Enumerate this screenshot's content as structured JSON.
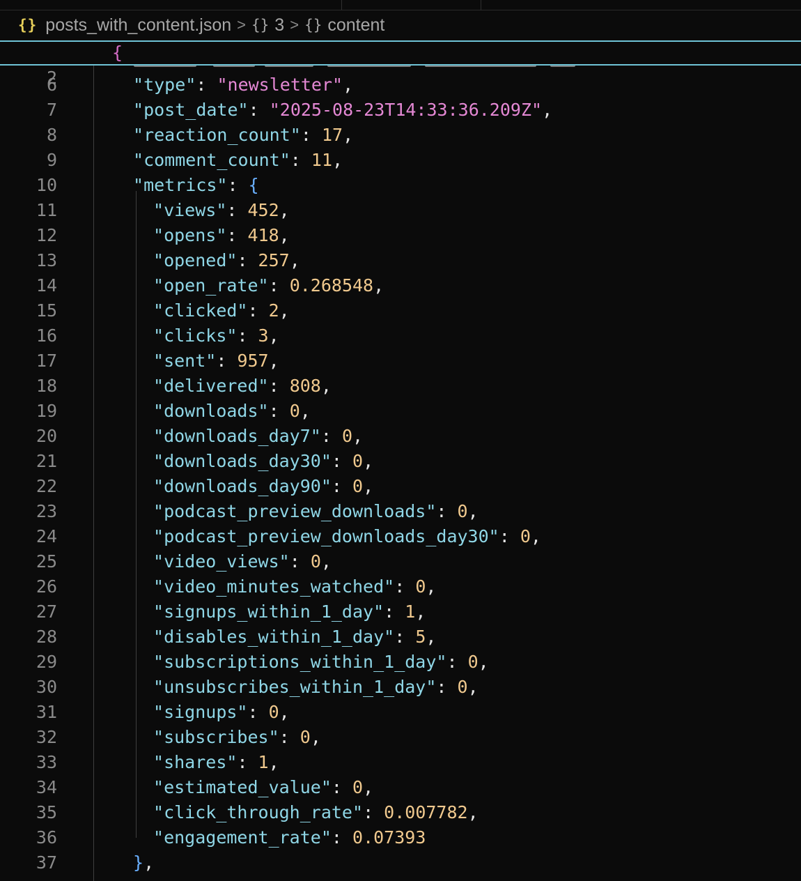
{
  "breadcrumb": {
    "file": "posts_with_content.json",
    "segments": [
      "3",
      "content"
    ]
  },
  "sticky_line": {
    "number": "2",
    "text": "{"
  },
  "lines": [
    {
      "n": "6",
      "indent": 1,
      "key": "type",
      "value": "newsletter",
      "vtype": "string",
      "comma": true
    },
    {
      "n": "7",
      "indent": 1,
      "key": "post_date",
      "value": "2025-08-23T14:33:36.209Z",
      "vtype": "string",
      "comma": true
    },
    {
      "n": "8",
      "indent": 1,
      "key": "reaction_count",
      "value": "17",
      "vtype": "number",
      "comma": true
    },
    {
      "n": "9",
      "indent": 1,
      "key": "comment_count",
      "value": "11",
      "vtype": "number",
      "comma": true
    },
    {
      "n": "10",
      "indent": 1,
      "key": "metrics",
      "value": "{",
      "vtype": "open",
      "comma": false
    },
    {
      "n": "11",
      "indent": 2,
      "key": "views",
      "value": "452",
      "vtype": "number",
      "comma": true
    },
    {
      "n": "12",
      "indent": 2,
      "key": "opens",
      "value": "418",
      "vtype": "number",
      "comma": true
    },
    {
      "n": "13",
      "indent": 2,
      "key": "opened",
      "value": "257",
      "vtype": "number",
      "comma": true
    },
    {
      "n": "14",
      "indent": 2,
      "key": "open_rate",
      "value": "0.268548",
      "vtype": "number",
      "comma": true
    },
    {
      "n": "15",
      "indent": 2,
      "key": "clicked",
      "value": "2",
      "vtype": "number",
      "comma": true
    },
    {
      "n": "16",
      "indent": 2,
      "key": "clicks",
      "value": "3",
      "vtype": "number",
      "comma": true
    },
    {
      "n": "17",
      "indent": 2,
      "key": "sent",
      "value": "957",
      "vtype": "number",
      "comma": true
    },
    {
      "n": "18",
      "indent": 2,
      "key": "delivered",
      "value": "808",
      "vtype": "number",
      "comma": true
    },
    {
      "n": "19",
      "indent": 2,
      "key": "downloads",
      "value": "0",
      "vtype": "number",
      "comma": true
    },
    {
      "n": "20",
      "indent": 2,
      "key": "downloads_day7",
      "value": "0",
      "vtype": "number",
      "comma": true
    },
    {
      "n": "21",
      "indent": 2,
      "key": "downloads_day30",
      "value": "0",
      "vtype": "number",
      "comma": true
    },
    {
      "n": "22",
      "indent": 2,
      "key": "downloads_day90",
      "value": "0",
      "vtype": "number",
      "comma": true
    },
    {
      "n": "23",
      "indent": 2,
      "key": "podcast_preview_downloads",
      "value": "0",
      "vtype": "number",
      "comma": true
    },
    {
      "n": "24",
      "indent": 2,
      "key": "podcast_preview_downloads_day30",
      "value": "0",
      "vtype": "number",
      "comma": true
    },
    {
      "n": "25",
      "indent": 2,
      "key": "video_views",
      "value": "0",
      "vtype": "number",
      "comma": true
    },
    {
      "n": "26",
      "indent": 2,
      "key": "video_minutes_watched",
      "value": "0",
      "vtype": "number",
      "comma": true
    },
    {
      "n": "27",
      "indent": 2,
      "key": "signups_within_1_day",
      "value": "1",
      "vtype": "number",
      "comma": true
    },
    {
      "n": "28",
      "indent": 2,
      "key": "disables_within_1_day",
      "value": "5",
      "vtype": "number",
      "comma": true
    },
    {
      "n": "29",
      "indent": 2,
      "key": "subscriptions_within_1_day",
      "value": "0",
      "vtype": "number",
      "comma": true
    },
    {
      "n": "30",
      "indent": 2,
      "key": "unsubscribes_within_1_day",
      "value": "0",
      "vtype": "number",
      "comma": true
    },
    {
      "n": "31",
      "indent": 2,
      "key": "signups",
      "value": "0",
      "vtype": "number",
      "comma": true
    },
    {
      "n": "32",
      "indent": 2,
      "key": "subscribes",
      "value": "0",
      "vtype": "number",
      "comma": true
    },
    {
      "n": "33",
      "indent": 2,
      "key": "shares",
      "value": "1",
      "vtype": "number",
      "comma": true
    },
    {
      "n": "34",
      "indent": 2,
      "key": "estimated_value",
      "value": "0",
      "vtype": "number",
      "comma": true
    },
    {
      "n": "35",
      "indent": 2,
      "key": "click_through_rate",
      "value": "0.007782",
      "vtype": "number",
      "comma": true
    },
    {
      "n": "36",
      "indent": 2,
      "key": "engagement_rate",
      "value": "0.07393",
      "vtype": "number",
      "comma": false
    },
    {
      "n": "37",
      "indent": 1,
      "key": "",
      "value": "}",
      "vtype": "close",
      "comma": true
    }
  ]
}
